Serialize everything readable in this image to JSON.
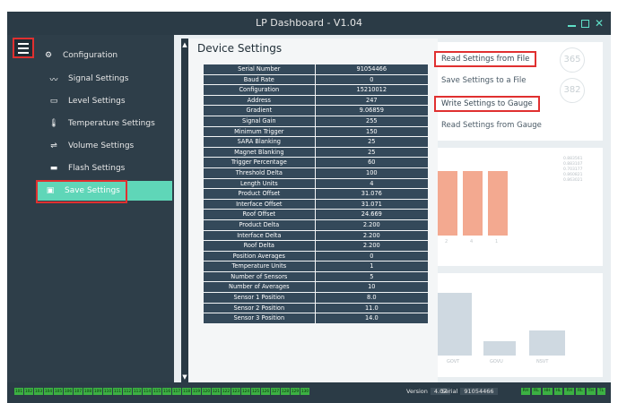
{
  "window": {
    "title": "LP Dashboard - V1.04"
  },
  "sidebar": {
    "items": [
      {
        "label": "Configuration",
        "icon": "gear-icon"
      },
      {
        "label": "Signal Settings",
        "icon": "signal-icon"
      },
      {
        "label": "Level Settings",
        "icon": "level-icon"
      },
      {
        "label": "Temperature Settings",
        "icon": "thermometer-icon"
      },
      {
        "label": "Volume Settings",
        "icon": "volume-icon"
      },
      {
        "label": "Flash Settings",
        "icon": "flash-icon"
      },
      {
        "label": "Save Settings",
        "icon": "save-icon"
      }
    ]
  },
  "device_settings": {
    "title": "Device Settings",
    "rows": [
      {
        "name": "Serial Number",
        "value": "91054466"
      },
      {
        "name": "Baud Rate",
        "value": "0"
      },
      {
        "name": "Configuration",
        "value": "15210012"
      },
      {
        "name": "Address",
        "value": "247"
      },
      {
        "name": "Gradient",
        "value": "9.06859"
      },
      {
        "name": "Signal Gain",
        "value": "255"
      },
      {
        "name": "Minimum Trigger",
        "value": "150"
      },
      {
        "name": "SARA Blanking",
        "value": "25"
      },
      {
        "name": "Magnet Blanking",
        "value": "25"
      },
      {
        "name": "Trigger Percentage",
        "value": "60"
      },
      {
        "name": "Threshold Delta",
        "value": "100"
      },
      {
        "name": "Length Units",
        "value": "4"
      },
      {
        "name": "Product Offset",
        "value": "31.076"
      },
      {
        "name": "Interface Offset",
        "value": "31.071"
      },
      {
        "name": "Roof Offset",
        "value": "24.669"
      },
      {
        "name": "Product Delta",
        "value": "2.200"
      },
      {
        "name": "Interface Delta",
        "value": "2.200"
      },
      {
        "name": "Roof Delta",
        "value": "2.200"
      },
      {
        "name": "Position Averages",
        "value": "0"
      },
      {
        "name": "Temperature Units",
        "value": "1"
      },
      {
        "name": "Number of Sensors",
        "value": "5"
      },
      {
        "name": "Number of Averages",
        "value": "10"
      },
      {
        "name": "Sensor 1 Position",
        "value": "8.0"
      },
      {
        "name": "Sensor 2 Position",
        "value": "11.0"
      },
      {
        "name": "Sensor 3 Position",
        "value": "14.0"
      }
    ]
  },
  "actions": {
    "read_file": "Read Settings from File",
    "save_file": "Save Settings to a File",
    "write_gauge": "Write Settings to Gauge",
    "read_gauge": "Read Settings from Gauge"
  },
  "background": {
    "chips": [
      "365",
      "382"
    ],
    "bar_labels": [
      "2",
      "4",
      "1"
    ],
    "legend": [
      "0.883561",
      "0.883107",
      "0.703177",
      "0.860821",
      "0.863021"
    ],
    "column_labels": [
      "GOVT",
      "GOVU",
      "NSVT"
    ]
  },
  "status": {
    "sensor_numbers": [
      "101",
      "102",
      "103",
      "104",
      "105",
      "106",
      "107",
      "108",
      "109",
      "110",
      "111",
      "112",
      "113",
      "114",
      "115",
      "116",
      "117",
      "118",
      "119",
      "120",
      "121",
      "122",
      "123",
      "124",
      "125",
      "126",
      "127",
      "128",
      "129",
      "130"
    ],
    "version_label": "Version",
    "version_value": "4.07",
    "serial_label": "Serial",
    "serial_value": "91054466",
    "flags": [
      "RH",
      "RL",
      "HH",
      "HL",
      "RH",
      "RL",
      "TH",
      "TL"
    ]
  },
  "colors": {
    "accent": "#5fd6b8",
    "highlight_box": "#e03030",
    "sidebar_bg": "#2e3e49",
    "table_cell": "#34495a",
    "status_green": "#3cb043"
  }
}
